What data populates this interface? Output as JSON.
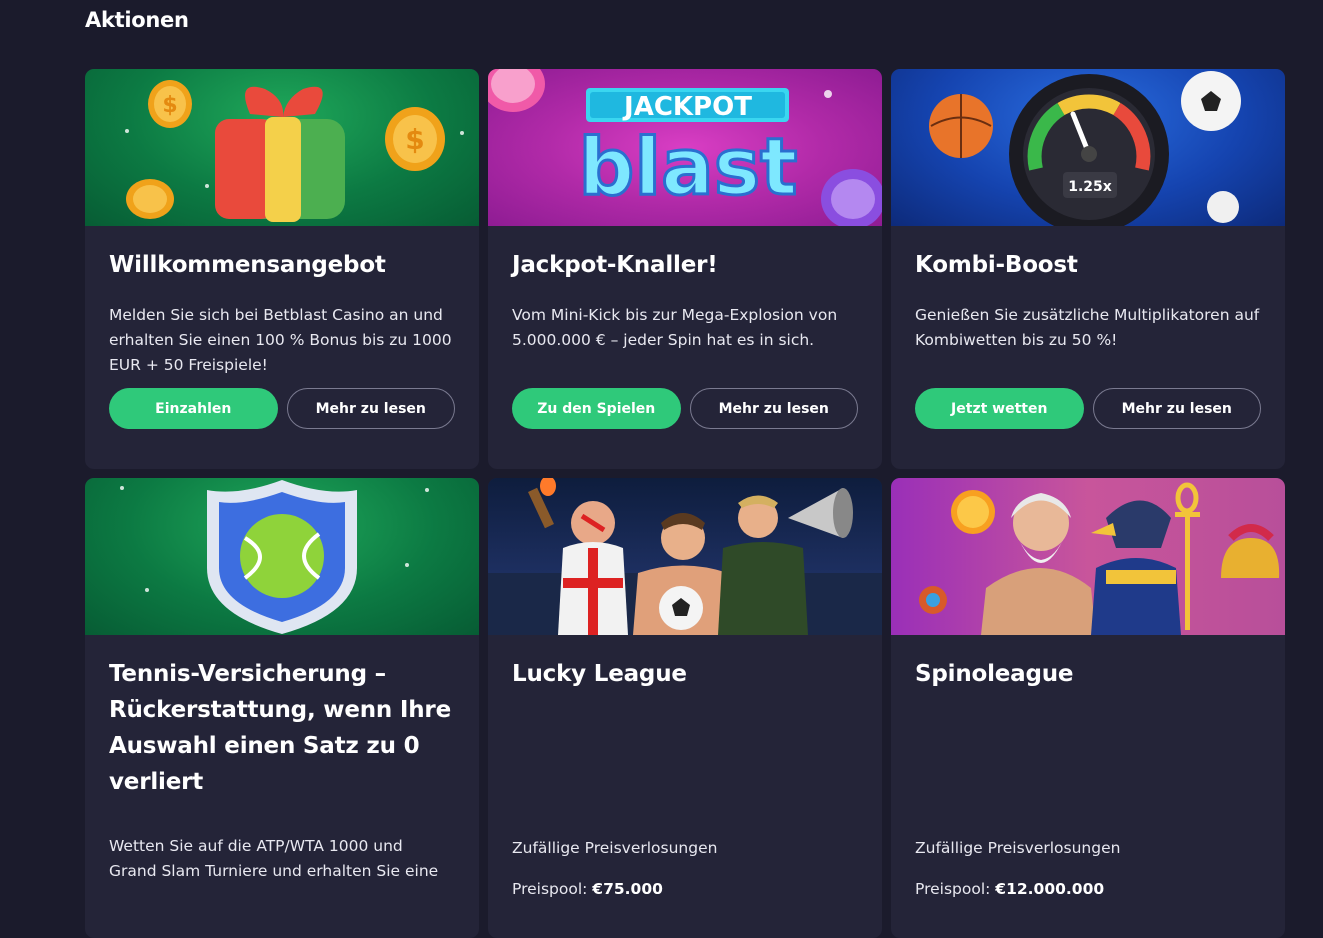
{
  "page": {
    "title": "Aktionen"
  },
  "cards": [
    {
      "title": "Willkommensangebot",
      "description": "Melden Sie sich bei Betblast Casino an und erhalten Sie einen 100 % Bonus bis zu 1000 EUR + 50 Freispiele!",
      "primary_label": "Einzahlen",
      "secondary_label": "Mehr zu lesen",
      "banner_icon": "gift-coins-icon"
    },
    {
      "title": "Jackpot-Knaller!",
      "description": "Vom Mini-Kick bis zur Mega-Explosion von 5.000.000 € – jeder Spin hat es in sich.",
      "primary_label": "Zu den Spielen",
      "secondary_label": "Mehr zu lesen",
      "banner_logo_top": "JACKPOT",
      "banner_logo_main": "blast"
    },
    {
      "title": "Kombi-Boost",
      "description": "Genießen Sie zusätzliche Multiplikatoren auf Kombiwetten bis zu 50 %!",
      "primary_label": "Jetzt wetten",
      "secondary_label": "Mehr zu lesen",
      "banner_gauge_value": "1.25x"
    },
    {
      "title": "Tennis-Versicherung – Rückerstattung, wenn Ihre Auswahl einen Satz zu 0 verliert",
      "description": "Wetten Sie auf die ATP/WTA 1000 und Grand Slam Turniere und erhalten Sie eine",
      "banner_icon": "tennis-shield-icon"
    },
    {
      "title": "Lucky League",
      "description": "Zufällige Preisverlosungen",
      "prize_label": "Preispool:",
      "prize_value": "€75.000",
      "banner_icon": "football-fans-illustration"
    },
    {
      "title": "Spinoleague",
      "description": "Zufällige Preisverlosungen",
      "prize_label": "Preispool:",
      "prize_value": "€12.000.000",
      "banner_icon": "gods-illustration"
    }
  ],
  "colors": {
    "background": "#1b1b2c",
    "card": "#242438",
    "accent_green": "#2fc97a"
  }
}
